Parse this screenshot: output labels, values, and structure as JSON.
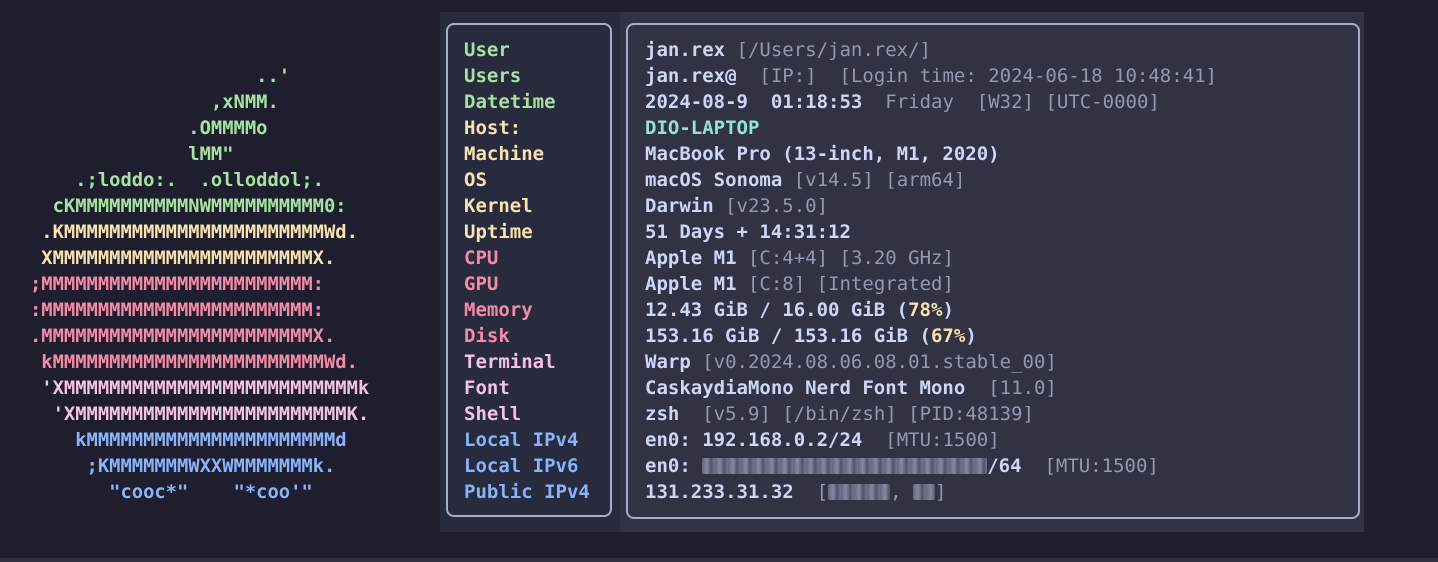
{
  "colors": {
    "background": "#1e1e2e",
    "panel": "#313244",
    "key_panel": "#282a3e",
    "border": "#a6adc8",
    "value_text": "#cdd6f4",
    "dim_text": "#9399b2",
    "highlight": "#f9e2af",
    "host": "#94e2d5",
    "green": "#a6e3a1",
    "yellow": "#f9e2af",
    "red": "#f38ba8",
    "pink": "#f5c2e7",
    "blue": "#89b4fa"
  },
  "logo": [
    {
      "text": "                    ..'",
      "color": "green"
    },
    {
      "text": "                ,xNMM.",
      "color": "green"
    },
    {
      "text": "              .OMMMMo",
      "color": "green"
    },
    {
      "text": "              lMM\"",
      "color": "green"
    },
    {
      "text": "    .;loddo:.  .olloddol;.",
      "color": "green"
    },
    {
      "text": "  cKMMMMMMMMMMNWMMMMMMMMMM0:",
      "color": "green"
    },
    {
      "text": " .KMMMMMMMMMMMMMMMMMMMMMMMWd.",
      "color": "yellow"
    },
    {
      "text": " XMMMMMMMMMMMMMMMMMMMMMMMX.",
      "color": "yellow"
    },
    {
      "text": ";MMMMMMMMMMMMMMMMMMMMMMMM:",
      "color": "red"
    },
    {
      "text": ":MMMMMMMMMMMMMMMMMMMMMMMM:",
      "color": "red"
    },
    {
      "text": ".MMMMMMMMMMMMMMMMMMMMMMMMX.",
      "color": "red"
    },
    {
      "text": " kMMMMMMMMMMMMMMMMMMMMMMMMWd.",
      "color": "red"
    },
    {
      "text": " 'XMMMMMMMMMMMMMMMMMMMMMMMMMMk",
      "color": "pink"
    },
    {
      "text": "  'XMMMMMMMMMMMMMMMMMMMMMMMMK.",
      "color": "pink"
    },
    {
      "text": "    kMMMMMMMMMMMMMMMMMMMMMMd",
      "color": "blue"
    },
    {
      "text": "     ;KMMMMMMMWXXWMMMMMMMk.",
      "color": "blue"
    },
    {
      "text": "       \"cooc*\"    \"*coo'\"",
      "color": "blue"
    }
  ],
  "keys": [
    {
      "label": "User",
      "color": "green"
    },
    {
      "label": "Users",
      "color": "green"
    },
    {
      "label": "Datetime",
      "color": "green"
    },
    {
      "label": "Host:",
      "color": "yellow"
    },
    {
      "label": "Machine",
      "color": "yellow"
    },
    {
      "label": "OS",
      "color": "yellow"
    },
    {
      "label": "Kernel",
      "color": "yellow"
    },
    {
      "label": "Uptime",
      "color": "yellow"
    },
    {
      "label": "CPU",
      "color": "red"
    },
    {
      "label": "GPU",
      "color": "red"
    },
    {
      "label": "Memory",
      "color": "red"
    },
    {
      "label": "Disk",
      "color": "red"
    },
    {
      "label": "Terminal",
      "color": "pink"
    },
    {
      "label": "Font",
      "color": "pink"
    },
    {
      "label": "Shell",
      "color": "pink"
    },
    {
      "label": "Local IPv4",
      "color": "blue"
    },
    {
      "label": "Local IPv6",
      "color": "blue"
    },
    {
      "label": "Public IPv4",
      "color": "blue"
    }
  ],
  "values": {
    "user": {
      "name": "jan.rex",
      "home": "[/Users/jan.rex/]"
    },
    "users": {
      "name": "jan.rex@",
      "ip": "[IP:]",
      "login": "[Login time: 2024-06-18 10:48:41]"
    },
    "datetime": {
      "date": "2024-08-9",
      "time": "01:18:53",
      "weekday": "Friday",
      "week": "[W32]",
      "tz": "[UTC-0000]"
    },
    "host": {
      "name": "DIO-LAPTOP"
    },
    "machine": {
      "model": "MacBook Pro (13-inch, M1, 2020)"
    },
    "os": {
      "name": "macOS Sonoma",
      "version": "[v14.5]",
      "arch": "[arm64]"
    },
    "kernel": {
      "name": "Darwin",
      "version": "[v23.5.0]"
    },
    "uptime": {
      "text": "51 Days + 14:31:12"
    },
    "cpu": {
      "name": "Apple M1",
      "cores": "[C:4+4]",
      "freq": "[3.20 GHz]"
    },
    "gpu": {
      "name": "Apple M1",
      "cores": "[C:8]",
      "type": "[Integrated]"
    },
    "memory": {
      "text": "12.43 GiB / 16.00 GiB (",
      "percent": "78%",
      "close": ")"
    },
    "disk": {
      "text": "153.16 GiB / 153.16 GiB (",
      "percent": "67%",
      "close": ")"
    },
    "terminal": {
      "name": "Warp",
      "version": "[v0.2024.08.06.08.01.stable_00]"
    },
    "font": {
      "name": "CaskaydiaMono Nerd Font Mono",
      "size": "[11.0]"
    },
    "shell": {
      "name": "zsh",
      "version": "[v5.9]",
      "path": "[/bin/zsh]",
      "pid": "[PID:48139]"
    },
    "local_ipv4": {
      "iface": "en0:",
      "addr": "192.168.0.2/24",
      "mtu": "[MTU:1500]"
    },
    "local_ipv6": {
      "iface": "en0:",
      "suffix": "/64",
      "mtu": "[MTU:1500]"
    },
    "public_ipv4": {
      "addr": "131.233.31.32",
      "open": "[",
      "sep": ",",
      "close": "]"
    }
  }
}
